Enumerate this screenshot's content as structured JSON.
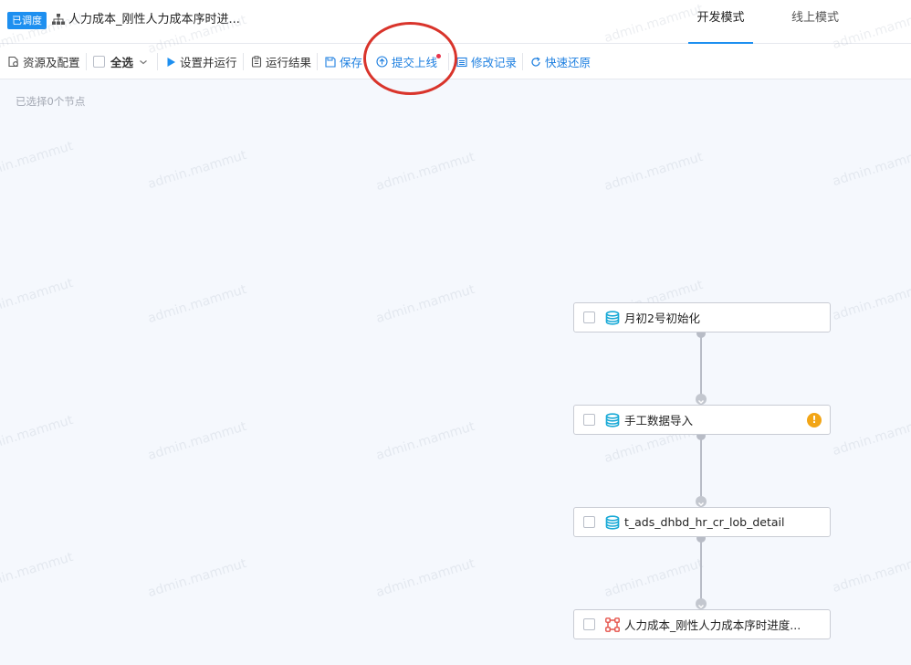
{
  "header": {
    "badge": "已调度",
    "title": "人力成本_刚性人力成本序时进...",
    "tabs": [
      {
        "label": "开发模式",
        "active": true
      },
      {
        "label": "线上模式",
        "active": false
      }
    ]
  },
  "toolbar": {
    "resources_label": "资源及配置",
    "select_all_label": "全选",
    "setup_run_label": "设置并运行",
    "run_result_label": "运行结果",
    "save_label": "保存",
    "submit_label": "提交上线",
    "history_label": "修改记录",
    "restore_label": "快速还原"
  },
  "canvas": {
    "selected_info": "已选择0个节点",
    "watermark": "admin.mammut",
    "nodes": [
      {
        "label": "月初2号初始化",
        "icon": "database-icon"
      },
      {
        "label": "手工数据导入",
        "icon": "database-icon",
        "warning": "!"
      },
      {
        "label": "t_ads_dhbd_hr_cr_lob_detail",
        "icon": "database-icon"
      },
      {
        "label": "人力成本_刚性人力成本序时进度...",
        "icon": "workflow-icon"
      }
    ]
  },
  "colors": {
    "accent": "#1d8ff0",
    "link": "#1d7fe0",
    "warning": "#f2a516",
    "highlight": "#d9342b",
    "db_icon": "#18a9d6",
    "workflow_icon": "#e5534b"
  }
}
